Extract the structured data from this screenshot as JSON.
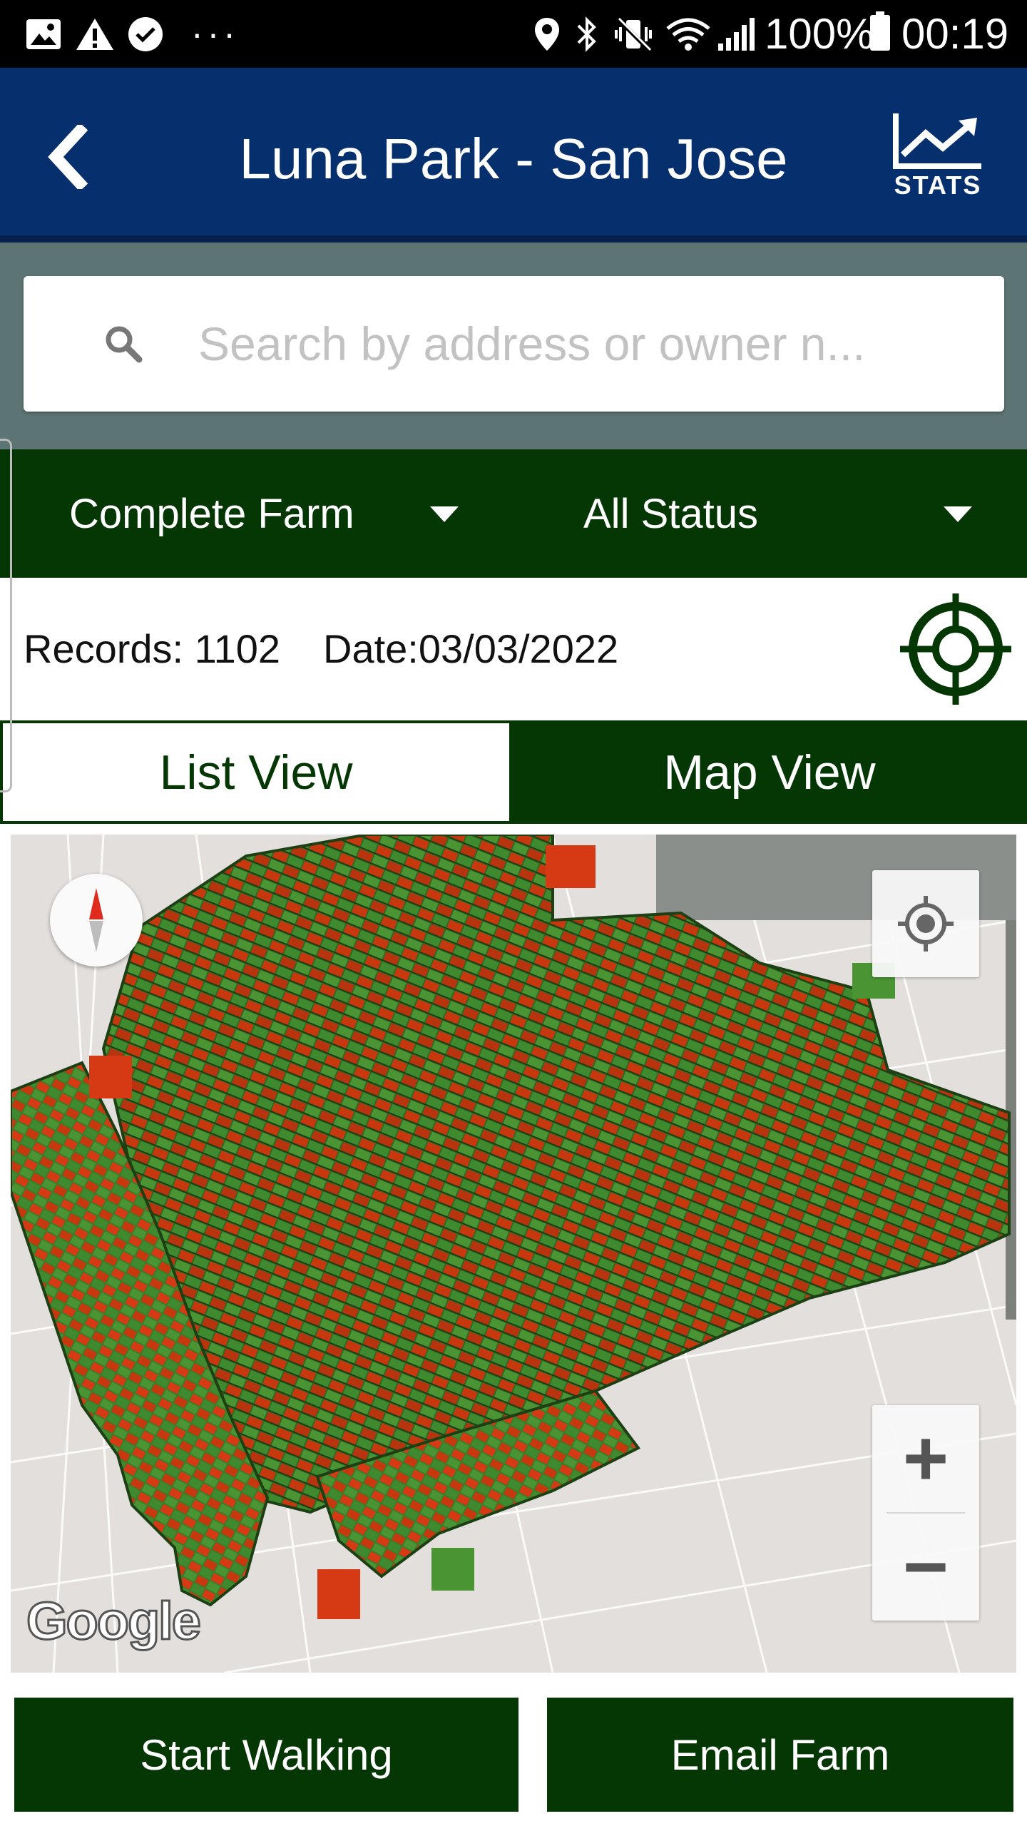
{
  "status_bar": {
    "battery": "100%",
    "time": "00:19",
    "more": "···",
    "icons": [
      "image-icon",
      "warning-icon",
      "chat-icon",
      "location-icon",
      "bluetooth-icon",
      "vibrate-icon",
      "wifi-icon",
      "signal-icon",
      "battery-icon"
    ]
  },
  "header": {
    "title": "Luna Park - San Jose",
    "stats_label": "STATS",
    "background": "#062f6e"
  },
  "search": {
    "placeholder": "Search by address or owner n..."
  },
  "filters": {
    "farm": "Complete Farm",
    "status": "All Status",
    "background": "#053705"
  },
  "info": {
    "records": "Records: 1102",
    "date": "Date:03/03/2022"
  },
  "tabs": {
    "list": "List View",
    "map": "Map View",
    "active": "map"
  },
  "map": {
    "attribution": "Google",
    "zoom_in": "+",
    "zoom_out": "−",
    "parcel_colors": {
      "positive": "#3f8a2f",
      "negative": "#d63a14"
    }
  },
  "actions": {
    "start_walking": "Start Walking",
    "email_farm": "Email Farm"
  }
}
